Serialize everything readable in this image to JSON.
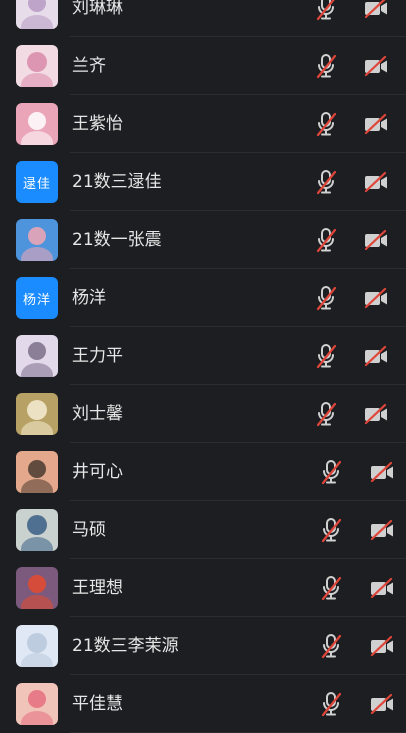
{
  "participants": [
    {
      "name": "刘琳琳",
      "avatar": {
        "kind": "image",
        "bg": "#e7dce9",
        "fg": "#b79ac4"
      }
    },
    {
      "name": "兰齐",
      "avatar": {
        "kind": "image",
        "bg": "#f3dbe4",
        "fg": "#d889a8"
      }
    },
    {
      "name": "王紫怡",
      "avatar": {
        "kind": "image",
        "bg": "#eaa6b8",
        "fg": "#ffffff"
      }
    },
    {
      "name": "21数三逯佳",
      "avatar": {
        "kind": "text",
        "text": "逯佳"
      }
    },
    {
      "name": "21数一张震",
      "avatar": {
        "kind": "image",
        "bg": "#4e94dd",
        "fg": "#f2a6b3"
      }
    },
    {
      "name": "杨洋",
      "avatar": {
        "kind": "text",
        "text": "杨洋"
      }
    },
    {
      "name": "王力平",
      "avatar": {
        "kind": "image",
        "bg": "#e2d9ea",
        "fg": "#7b6e8a"
      }
    },
    {
      "name": "刘士馨",
      "avatar": {
        "kind": "image",
        "bg": "#b8a164",
        "fg": "#f4ecd2"
      }
    },
    {
      "name": "井可心",
      "avatar": {
        "kind": "image",
        "bg": "#e4a98c",
        "fg": "#4a3a30"
      }
    },
    {
      "name": "马硕",
      "avatar": {
        "kind": "image",
        "bg": "#c9d2cf",
        "fg": "#3b5f86"
      }
    },
    {
      "name": "王理想",
      "avatar": {
        "kind": "image",
        "bg": "#7b5a7d",
        "fg": "#e64a2e"
      }
    },
    {
      "name": "21数三李茉源",
      "avatar": {
        "kind": "image",
        "bg": "#dfe8f4",
        "fg": "#b9c7da"
      }
    },
    {
      "name": "平佳慧",
      "avatar": {
        "kind": "image",
        "bg": "#f0c4b8",
        "fg": "#e56e7f"
      }
    }
  ],
  "mic_state": "muted",
  "camera_state": "off",
  "colors": {
    "icon_gray": "#d0d0d0",
    "slash_red": "#e0453a",
    "text_avatar_blue": "#1a8cff"
  }
}
